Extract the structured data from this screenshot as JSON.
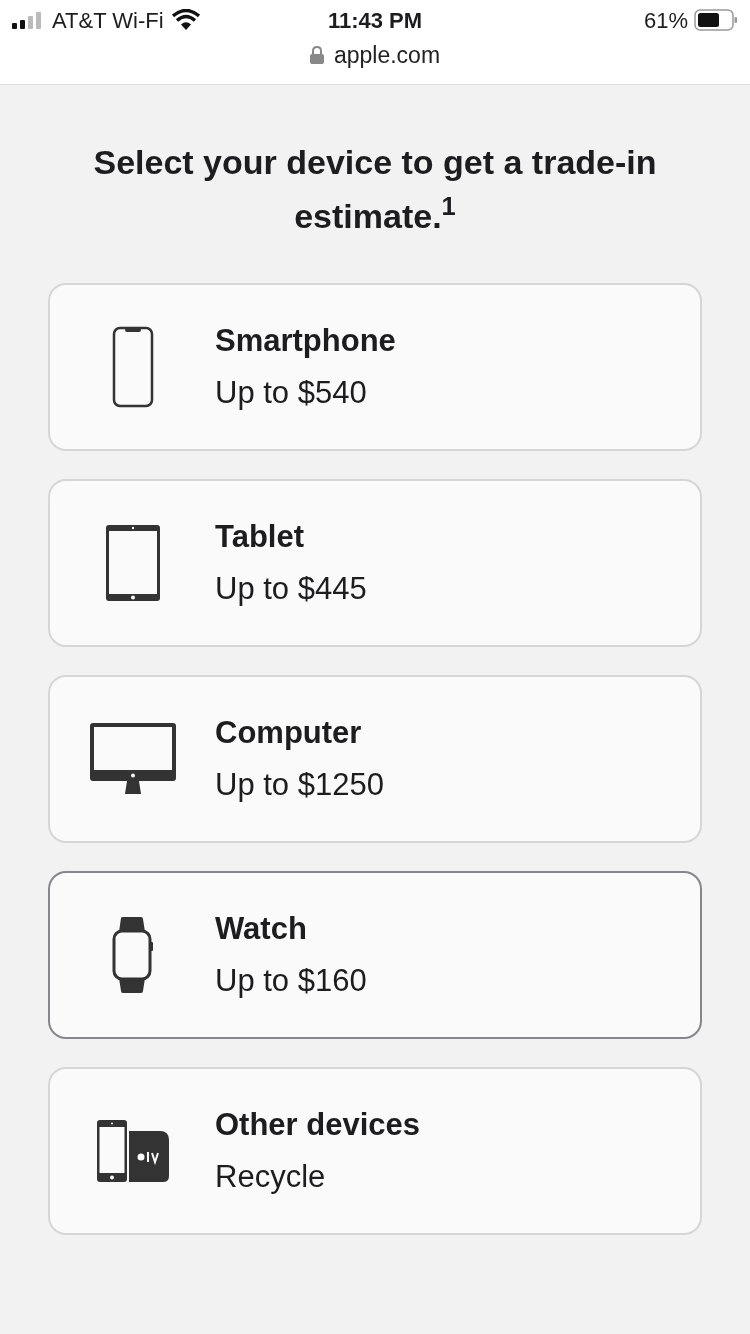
{
  "status_bar": {
    "carrier": "AT&T Wi-Fi",
    "time": "11:43 PM",
    "battery": "61%"
  },
  "address_bar": {
    "url": "apple.com"
  },
  "heading": "Select your device to get a trade-in estimate.$^{1}$",
  "devices": [
    {
      "kind": "smartphone",
      "name": "Smartphone",
      "value": "Up to $540",
      "selected": false
    },
    {
      "kind": "tablet",
      "name": "Tablet",
      "value": "Up to $445",
      "selected": false
    },
    {
      "kind": "computer",
      "name": "Computer",
      "value": "Up to $1250",
      "selected": false
    },
    {
      "kind": "watch",
      "name": "Watch",
      "value": "Up to $160",
      "selected": true
    },
    {
      "kind": "other",
      "name": "Other devices",
      "value": "Recycle",
      "selected": false
    }
  ]
}
